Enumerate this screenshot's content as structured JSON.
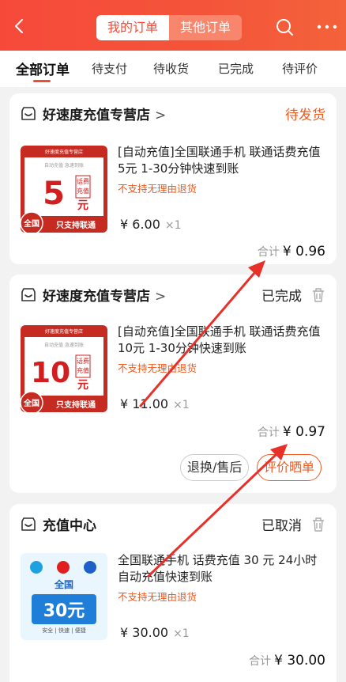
{
  "header": {
    "tab_active": "我的订单",
    "tab_other": "其他订单"
  },
  "tabs": [
    "全部订单",
    "待支付",
    "待收货",
    "已完成",
    "待评价"
  ],
  "orders": [
    {
      "shop": "好速度充值专营店",
      "status": "待发货",
      "thumb": {
        "top_label": "好速度充值专营店",
        "sub_label": "自动充值  急速到账",
        "amount": "5",
        "tag1": "话费",
        "tag2": "充值",
        "unit": "元",
        "region": "全国",
        "carrier_note": "只支持联通"
      },
      "title": "[自动充值]全国联通手机 联通话费充值5元 1-30分钟快速到账",
      "no_refund": "不支持无理由退货",
      "price": "¥ 6.00",
      "qty": "×1",
      "total_label": "合计",
      "total": "¥ 0.96"
    },
    {
      "shop": "好速度充值专营店",
      "status": "已完成",
      "thumb": {
        "top_label": "好速度充值专营店",
        "sub_label": "自动充值  急速到账",
        "amount": "10",
        "tag1": "话费",
        "tag2": "充值",
        "unit": "元",
        "region": "全国",
        "carrier_note": "只支持联通"
      },
      "title": "[自动充值]全国联通手机 联通话费充值10元 1-30分钟快速到账",
      "no_refund": "不支持无理由退货",
      "price": "¥ 11.00",
      "qty": "×1",
      "total_label": "合计",
      "total": "¥ 0.97",
      "buttons": [
        "退换/售后",
        "评价晒单"
      ]
    },
    {
      "shop": "充值中心",
      "status": "已取消",
      "thumb": {
        "region": "全国",
        "amount": "30元",
        "tagline": "安全 | 快速 | 便捷"
      },
      "title": "全国联通手机 话费充值 30 元 24小时自动充值快速到账",
      "no_refund": "不支持无理由退货",
      "price": "¥ 30.00",
      "qty": "×1",
      "total_label": "合计",
      "total": "¥ 30.00"
    }
  ],
  "colors": {
    "header_red": "#f6493a",
    "accent_orange": "#f05a1e",
    "annotation_arrow": "#e8302a"
  }
}
